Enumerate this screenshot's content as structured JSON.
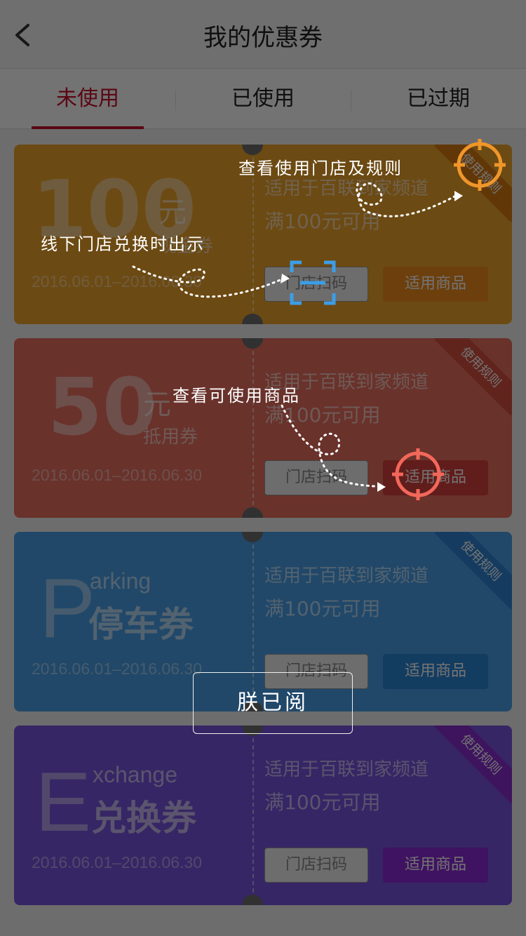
{
  "header": {
    "title": "我的优惠券",
    "back_icon": "chevron-left-icon"
  },
  "tabs": [
    {
      "label": "未使用",
      "active": true
    },
    {
      "label": "已使用",
      "active": false
    },
    {
      "label": "已过期",
      "active": false
    }
  ],
  "coupons": [
    {
      "amount": "100",
      "unit": "元",
      "sub": "现金券",
      "date": "2016.06.01–2016.06.30",
      "scope": "适用于百联到家频道",
      "condition": "满100元可用",
      "store_btn": "门店扫码",
      "goods_btn": "适用商品",
      "ribbon": "使用规则",
      "color": "#f0a42c",
      "btn_color": "#f08c1e"
    },
    {
      "amount": "50",
      "unit": "元",
      "sub": "抵用券",
      "date": "2016.06.01–2016.06.30",
      "scope": "适用于百联到家频道",
      "condition": "满100元可用",
      "store_btn": "门店扫码",
      "goods_btn": "适用商品",
      "ribbon": "使用规则",
      "color": "#e87060",
      "btn_color": "#d8413c"
    },
    {
      "letter": "P",
      "word": "arking",
      "sub": "停车券",
      "date": "2016.06.01–2016.06.30",
      "scope": "适用于百联到家频道",
      "condition": "满100元可用",
      "store_btn": "门店扫码",
      "goods_btn": "适用商品",
      "ribbon": "使用规则",
      "color": "#4aa0e8",
      "btn_color": "#2b86d8"
    },
    {
      "letter": "E",
      "word": "xchange",
      "sub": "兑换券",
      "date": "2016.06.01–2016.06.30",
      "scope": "适用于百联到家频道",
      "condition": "满100元可用",
      "store_btn": "门店扫码",
      "goods_btn": "适用商品",
      "ribbon": "使用规则",
      "color": "#7a55e0",
      "btn_color": "#8d2cd8"
    }
  ],
  "guide": {
    "hint_rules": "查看使用门店及规则",
    "hint_store": "线下门店兑换时出示",
    "hint_goods": "查看可使用商品",
    "ack_button": "朕已阅"
  }
}
